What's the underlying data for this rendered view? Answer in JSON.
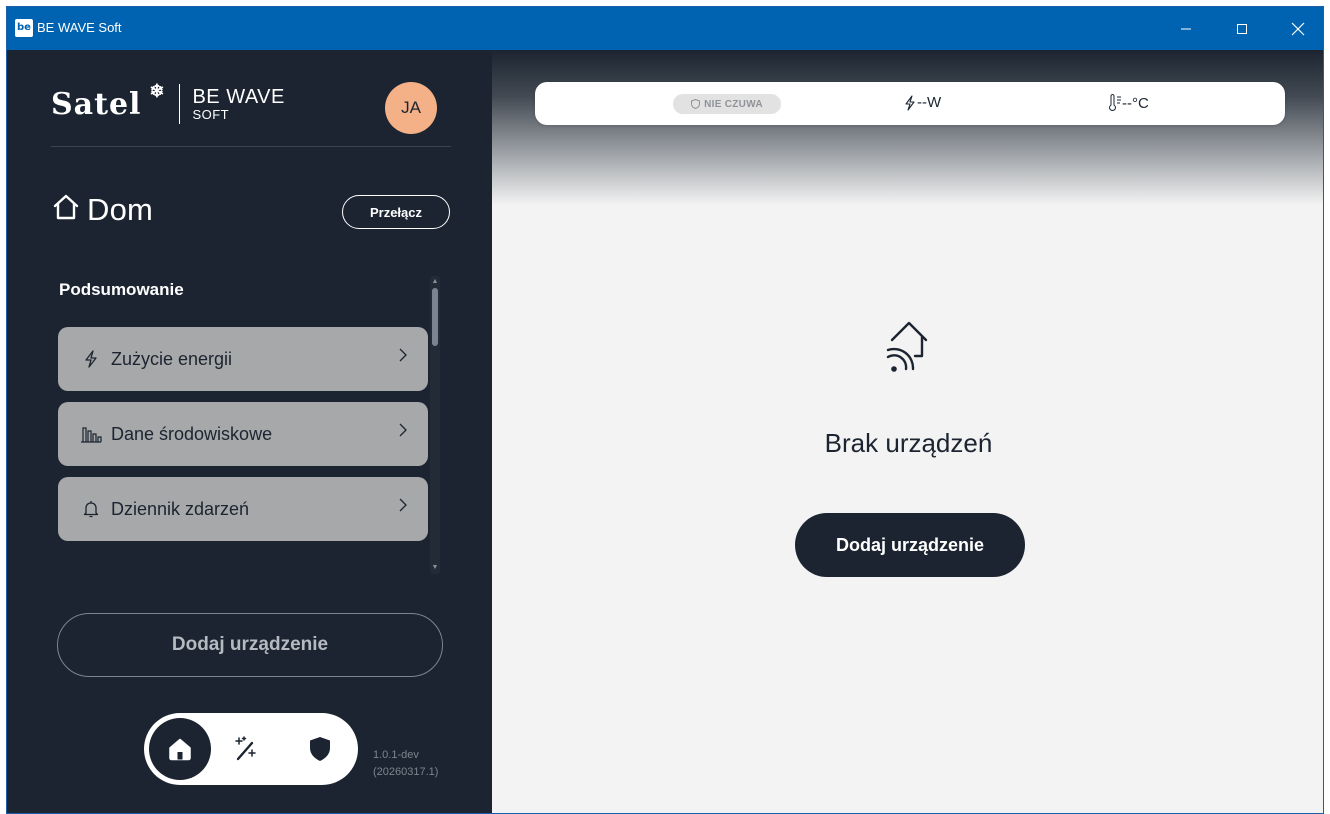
{
  "window": {
    "app_icon_text": "be",
    "title": "BE WAVE Soft"
  },
  "sidebar": {
    "logo": {
      "brand": "Satel",
      "product_line1": "BE WAVE",
      "product_line2": "SOFT"
    },
    "avatar_initials": "JA",
    "home_name": "Dom",
    "switch_label": "Przełącz",
    "section_label": "Podsumowanie",
    "menu": [
      {
        "label": "Zużycie energii",
        "icon": "lightning-icon"
      },
      {
        "label": "Dane środowiskowe",
        "icon": "chart-bars-icon"
      },
      {
        "label": "Dziennik zdarzeń",
        "icon": "bell-icon"
      }
    ],
    "add_device_label": "Dodaj urządzenie",
    "bottom_nav": [
      "home-icon",
      "magic-wand-icon",
      "shield-icon"
    ],
    "version_line1": "1.0.1-dev",
    "version_line2": "(20260317.1)"
  },
  "status_bar": {
    "arm_status": "NIE CZUWA",
    "power": "--W",
    "temperature": "--°C"
  },
  "main": {
    "empty_title": "Brak urządzeń",
    "add_device_label": "Dodaj urządzenie"
  },
  "colors": {
    "titlebar": "#0063b1",
    "sidebar": "#1b2430",
    "menu_item": "#a7a8a9",
    "avatar": "#f4b086"
  }
}
